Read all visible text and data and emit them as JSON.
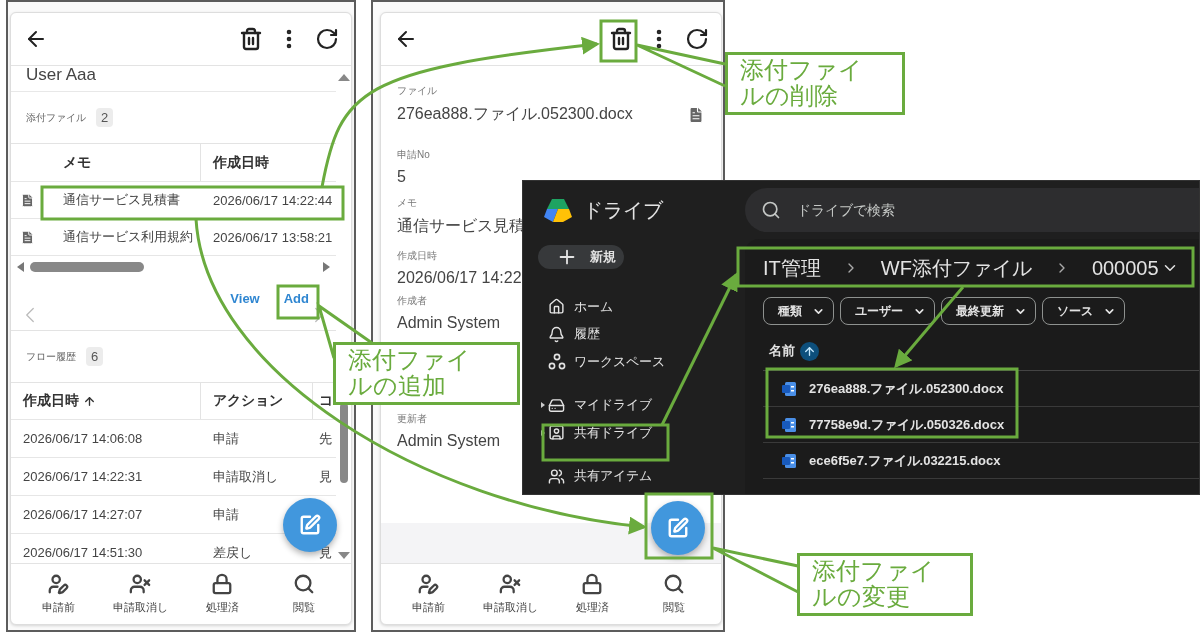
{
  "list_screen": {
    "user_name": "User Aaa",
    "attachments": {
      "label": "添付ファイル",
      "count": "2",
      "columns": [
        "メモ",
        "作成日時"
      ],
      "rows": [
        {
          "memo": "通信サービス見積書",
          "created": "2026/06/17 14:22:44"
        },
        {
          "memo": "通信サービス利用規約",
          "created": "2026/06/17 13:58:21"
        }
      ],
      "actions": [
        "View",
        "Add"
      ]
    },
    "flow_history": {
      "label": "フロー履歴",
      "count": "6",
      "columns": [
        {
          "label": "作成日時",
          "sorted": true
        },
        {
          "label": "アクション",
          "sorted": false
        },
        {
          "label": "コ",
          "sorted": false
        }
      ],
      "rows": [
        [
          "2026/06/17 14:06:08",
          "申請",
          "先"
        ],
        [
          "2026/06/17 14:22:31",
          "申請取消し",
          "見"
        ],
        [
          "2026/06/17 14:27:07",
          "申請"
        ],
        [
          "2026/06/17 14:51:30",
          "差戻し",
          "見"
        ]
      ]
    },
    "bottom_nav": [
      "申請前",
      "申請取消し",
      "処理済",
      "閲覧"
    ]
  },
  "detail_screen": {
    "fields": [
      {
        "kind": "file",
        "label": "ファイル",
        "value": "276ea888.ファイル.052300.docx"
      },
      {
        "kind": "text",
        "label": "申請No",
        "value": "5"
      },
      {
        "kind": "text",
        "label": "メモ",
        "value": "通信サービス見積"
      },
      {
        "kind": "text",
        "label": "作成日時",
        "value": "2026/06/17 14:22"
      },
      {
        "kind": "text",
        "label": "作成者",
        "value": "Admin System"
      },
      {
        "kind": "text",
        "label": "更新者",
        "value": "Admin System"
      }
    ],
    "bottom_nav": [
      "申請前",
      "申請取消し",
      "処理済",
      "閲覧"
    ]
  },
  "drive_window": {
    "app_name": "ドライブ",
    "search": {
      "placeholder": "ドライブで検索"
    },
    "new_button": "新規",
    "nav_groups": [
      [
        {
          "label": "ホーム",
          "expandable": false
        },
        {
          "label": "履歴",
          "expandable": false
        },
        {
          "label": "ワークスペース",
          "expandable": false
        }
      ],
      [
        {
          "label": "マイドライブ",
          "expandable": true
        },
        {
          "label": "共有ドライブ",
          "expandable": true
        }
      ],
      [
        {
          "label": "共有アイテム",
          "expandable": false
        }
      ]
    ],
    "breadcrumb": [
      "IT管理",
      "WF添付ファイル",
      "000005"
    ],
    "filters": [
      "種類",
      "ユーザー",
      "最終更新",
      "ソース"
    ],
    "name_column": {
      "label": "名前",
      "sorted": true
    },
    "files": [
      "276ea888.ファイル.052300.docx",
      "77758e9d.ファイル.050326.docx",
      "ece6f5e7.ファイル.032215.docx"
    ]
  },
  "callouts": [
    {
      "text": "添付ファイルの削除"
    },
    {
      "text": "添付ファイルの追加"
    },
    {
      "text": "添付ファイルの変更"
    }
  ]
}
